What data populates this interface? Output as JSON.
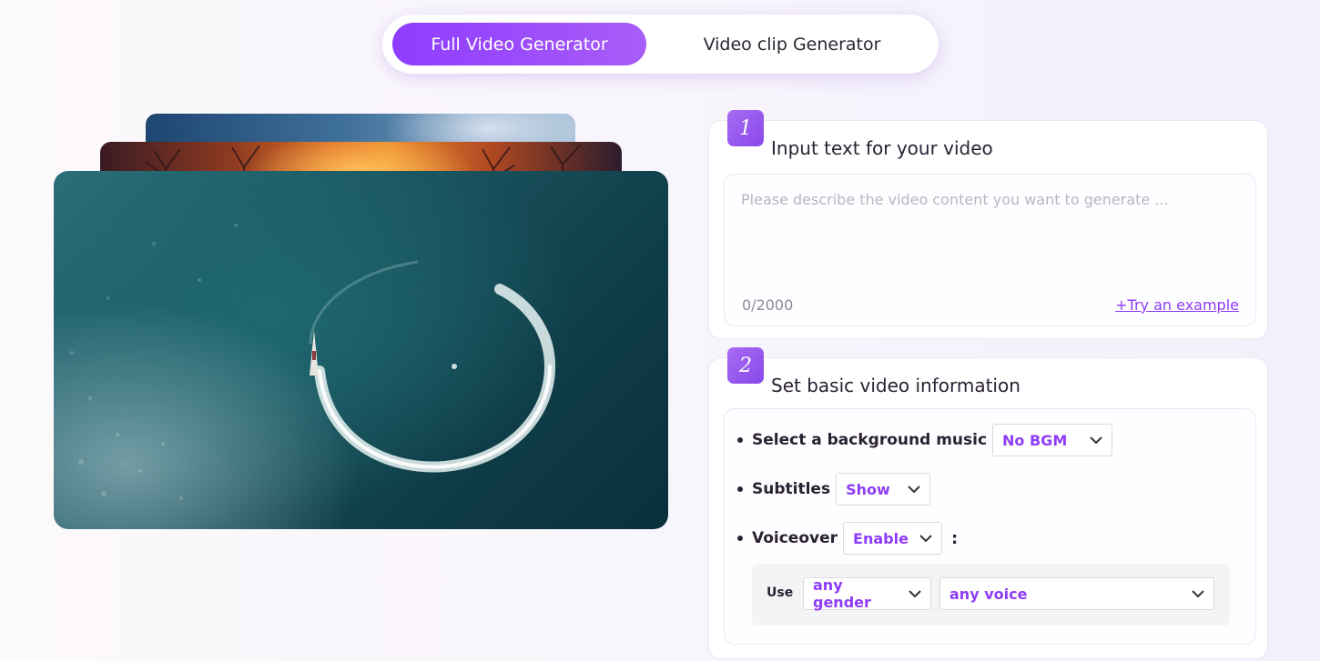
{
  "tabs": [
    {
      "label": "Full Video Generator",
      "active": true
    },
    {
      "label": "Video clip Generator",
      "active": false
    }
  ],
  "step1": {
    "number": "1",
    "title": "Input text for your video",
    "placeholder": "Please describe the video content you want to generate ...",
    "value": "",
    "char_count": "0/2000",
    "try_example": "+Try an example"
  },
  "step2": {
    "number": "2",
    "title": "Set basic video information",
    "background_music": {
      "label": "Select a background music",
      "value": "No BGM"
    },
    "subtitles": {
      "label": "Subtitles",
      "value": "Show"
    },
    "voiceover": {
      "label": "Voiceover",
      "value": "Enable",
      "suffix": ":"
    },
    "use": {
      "label": "Use",
      "gender": "any gender",
      "voice": "any voice"
    }
  },
  "colors": {
    "accent": "#8e3cf7",
    "tab_gradient_start": "#8e3cff",
    "tab_gradient_end": "#a95df7",
    "badge": "#9a5af0"
  },
  "icons": [
    "chevron-down-icon"
  ]
}
